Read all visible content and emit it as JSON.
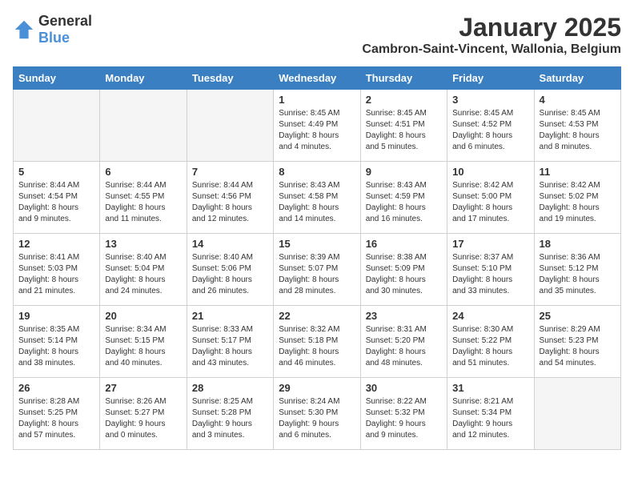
{
  "header": {
    "logo_general": "General",
    "logo_blue": "Blue",
    "month_year": "January 2025",
    "location": "Cambron-Saint-Vincent, Wallonia, Belgium"
  },
  "weekdays": [
    "Sunday",
    "Monday",
    "Tuesday",
    "Wednesday",
    "Thursday",
    "Friday",
    "Saturday"
  ],
  "weeks": [
    [
      {
        "day": "",
        "info": ""
      },
      {
        "day": "",
        "info": ""
      },
      {
        "day": "",
        "info": ""
      },
      {
        "day": "1",
        "info": "Sunrise: 8:45 AM\nSunset: 4:49 PM\nDaylight: 8 hours\nand 4 minutes."
      },
      {
        "day": "2",
        "info": "Sunrise: 8:45 AM\nSunset: 4:51 PM\nDaylight: 8 hours\nand 5 minutes."
      },
      {
        "day": "3",
        "info": "Sunrise: 8:45 AM\nSunset: 4:52 PM\nDaylight: 8 hours\nand 6 minutes."
      },
      {
        "day": "4",
        "info": "Sunrise: 8:45 AM\nSunset: 4:53 PM\nDaylight: 8 hours\nand 8 minutes."
      }
    ],
    [
      {
        "day": "5",
        "info": "Sunrise: 8:44 AM\nSunset: 4:54 PM\nDaylight: 8 hours\nand 9 minutes."
      },
      {
        "day": "6",
        "info": "Sunrise: 8:44 AM\nSunset: 4:55 PM\nDaylight: 8 hours\nand 11 minutes."
      },
      {
        "day": "7",
        "info": "Sunrise: 8:44 AM\nSunset: 4:56 PM\nDaylight: 8 hours\nand 12 minutes."
      },
      {
        "day": "8",
        "info": "Sunrise: 8:43 AM\nSunset: 4:58 PM\nDaylight: 8 hours\nand 14 minutes."
      },
      {
        "day": "9",
        "info": "Sunrise: 8:43 AM\nSunset: 4:59 PM\nDaylight: 8 hours\nand 16 minutes."
      },
      {
        "day": "10",
        "info": "Sunrise: 8:42 AM\nSunset: 5:00 PM\nDaylight: 8 hours\nand 17 minutes."
      },
      {
        "day": "11",
        "info": "Sunrise: 8:42 AM\nSunset: 5:02 PM\nDaylight: 8 hours\nand 19 minutes."
      }
    ],
    [
      {
        "day": "12",
        "info": "Sunrise: 8:41 AM\nSunset: 5:03 PM\nDaylight: 8 hours\nand 21 minutes."
      },
      {
        "day": "13",
        "info": "Sunrise: 8:40 AM\nSunset: 5:04 PM\nDaylight: 8 hours\nand 24 minutes."
      },
      {
        "day": "14",
        "info": "Sunrise: 8:40 AM\nSunset: 5:06 PM\nDaylight: 8 hours\nand 26 minutes."
      },
      {
        "day": "15",
        "info": "Sunrise: 8:39 AM\nSunset: 5:07 PM\nDaylight: 8 hours\nand 28 minutes."
      },
      {
        "day": "16",
        "info": "Sunrise: 8:38 AM\nSunset: 5:09 PM\nDaylight: 8 hours\nand 30 minutes."
      },
      {
        "day": "17",
        "info": "Sunrise: 8:37 AM\nSunset: 5:10 PM\nDaylight: 8 hours\nand 33 minutes."
      },
      {
        "day": "18",
        "info": "Sunrise: 8:36 AM\nSunset: 5:12 PM\nDaylight: 8 hours\nand 35 minutes."
      }
    ],
    [
      {
        "day": "19",
        "info": "Sunrise: 8:35 AM\nSunset: 5:14 PM\nDaylight: 8 hours\nand 38 minutes."
      },
      {
        "day": "20",
        "info": "Sunrise: 8:34 AM\nSunset: 5:15 PM\nDaylight: 8 hours\nand 40 minutes."
      },
      {
        "day": "21",
        "info": "Sunrise: 8:33 AM\nSunset: 5:17 PM\nDaylight: 8 hours\nand 43 minutes."
      },
      {
        "day": "22",
        "info": "Sunrise: 8:32 AM\nSunset: 5:18 PM\nDaylight: 8 hours\nand 46 minutes."
      },
      {
        "day": "23",
        "info": "Sunrise: 8:31 AM\nSunset: 5:20 PM\nDaylight: 8 hours\nand 48 minutes."
      },
      {
        "day": "24",
        "info": "Sunrise: 8:30 AM\nSunset: 5:22 PM\nDaylight: 8 hours\nand 51 minutes."
      },
      {
        "day": "25",
        "info": "Sunrise: 8:29 AM\nSunset: 5:23 PM\nDaylight: 8 hours\nand 54 minutes."
      }
    ],
    [
      {
        "day": "26",
        "info": "Sunrise: 8:28 AM\nSunset: 5:25 PM\nDaylight: 8 hours\nand 57 minutes."
      },
      {
        "day": "27",
        "info": "Sunrise: 8:26 AM\nSunset: 5:27 PM\nDaylight: 9 hours\nand 0 minutes."
      },
      {
        "day": "28",
        "info": "Sunrise: 8:25 AM\nSunset: 5:28 PM\nDaylight: 9 hours\nand 3 minutes."
      },
      {
        "day": "29",
        "info": "Sunrise: 8:24 AM\nSunset: 5:30 PM\nDaylight: 9 hours\nand 6 minutes."
      },
      {
        "day": "30",
        "info": "Sunrise: 8:22 AM\nSunset: 5:32 PM\nDaylight: 9 hours\nand 9 minutes."
      },
      {
        "day": "31",
        "info": "Sunrise: 8:21 AM\nSunset: 5:34 PM\nDaylight: 9 hours\nand 12 minutes."
      },
      {
        "day": "",
        "info": ""
      }
    ]
  ]
}
